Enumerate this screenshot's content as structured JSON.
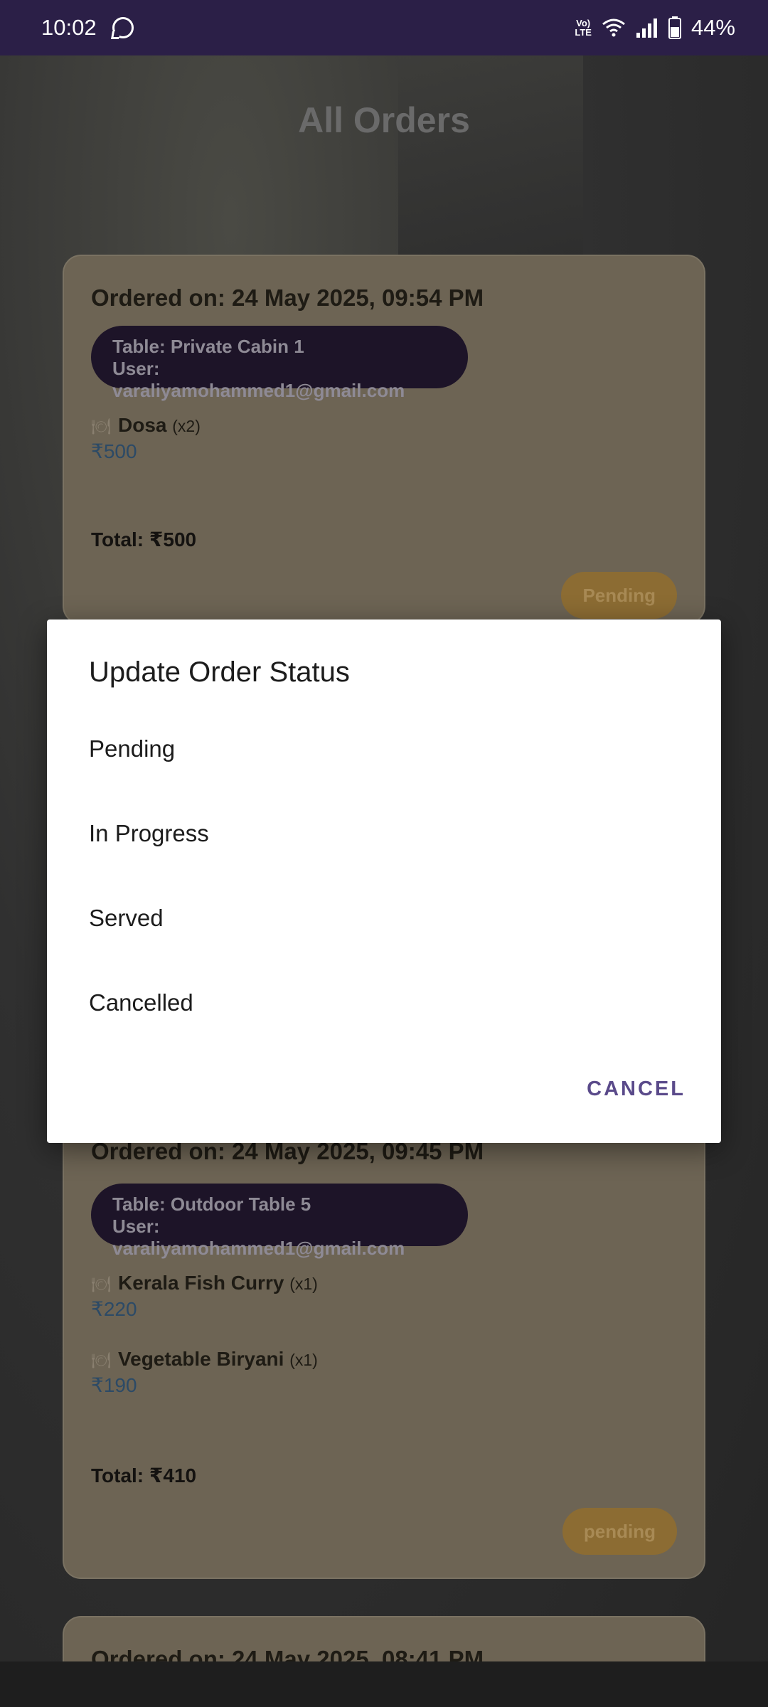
{
  "status_bar": {
    "time": "10:02",
    "volte": "Vo)\nLTE",
    "battery": "44%",
    "icons": [
      "whatsapp-icon",
      "volte-icon",
      "wifi-icon",
      "signal-icon",
      "battery-icon"
    ]
  },
  "page": {
    "title": "All Orders"
  },
  "orders": [
    {
      "ordered_on_label": "Ordered on:",
      "ordered_on_value": "24 May 2025, 09:54 PM",
      "table": "Table: Private Cabin 1",
      "user": "User: varaliyamohammed1@gmail.com",
      "items": [
        {
          "name": "Dosa",
          "qty": "(x2)",
          "price": "₹500"
        }
      ],
      "total": "Total: ₹500",
      "status": "Pending"
    },
    {
      "ordered_on_label": "Ordered on:",
      "ordered_on_value": "24 May 2025, 09:45 PM",
      "table": "Table: Outdoor Table 5",
      "user": "User: varaliyamohammed1@gmail.com",
      "items": [
        {
          "name": "Kerala Fish Curry",
          "qty": "(x1)",
          "price": "₹220"
        },
        {
          "name": "Vegetable Biryani",
          "qty": "(x1)",
          "price": "₹190"
        }
      ],
      "total": "Total: ₹410",
      "status": "pending"
    },
    {
      "ordered_on_label": "Ordered on:",
      "ordered_on_value": "24 May 2025, 08:41 PM"
    }
  ],
  "dialog": {
    "title": "Update Order Status",
    "options": [
      "Pending",
      "In Progress",
      "Served",
      "Cancelled"
    ],
    "cancel_label": "CANCEL"
  },
  "colors": {
    "status_bar_bg": "#2b1f47",
    "pill_bg": "#1d1428",
    "badge_bg": "#8c6c33",
    "accent": "#5a4a8a"
  }
}
